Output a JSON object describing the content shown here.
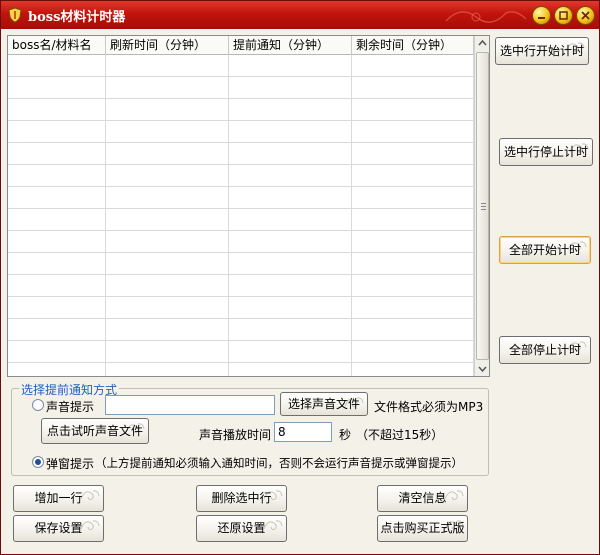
{
  "window": {
    "title": "boss材料计时器"
  },
  "table": {
    "columns": [
      "boss名/材料名",
      "刷新时间（分钟）",
      "提前通知（分钟）",
      "剩余时间（分钟）"
    ],
    "row_count": 15
  },
  "side_buttons": {
    "start_selected": "选中行开始计时",
    "stop_selected": "选中行停止计时",
    "start_all": "全部开始计时",
    "stop_all": "全部停止计时"
  },
  "notify": {
    "legend": "选择提前通知方式",
    "sound_label": "声音提示",
    "sound_file_value": "",
    "choose_sound_button": "选择声音文件",
    "format_note": "文件格式必须为MP3",
    "test_sound_button": "点击试听声音文件",
    "duration_label": "声音播放时间",
    "duration_value": "8",
    "duration_unit": "秒",
    "duration_note": "（不超过15秒）",
    "popup_label": "弹窗提示",
    "popup_note": "（上方提前通知必须输入通知时间，否则不会运行声音提示或弹窗提示）",
    "selected": "popup"
  },
  "bottom_buttons": {
    "add_row": "增加一行",
    "delete_row": "删除选中行",
    "clear": "清空信息",
    "save": "保存设置",
    "restore": "还原设置",
    "buy": "点击购买正式版"
  }
}
